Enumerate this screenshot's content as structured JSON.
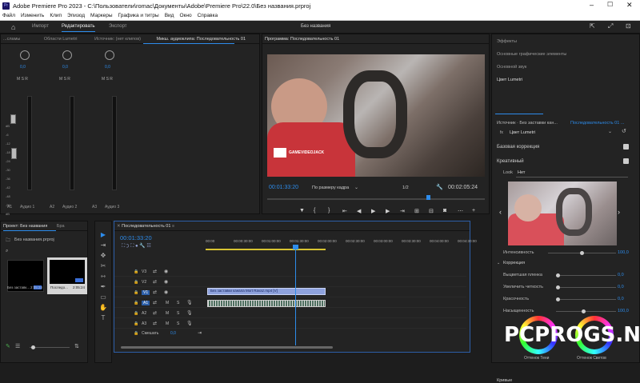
{
  "app": {
    "title": "Adobe Premiere Pro 2023 - C:\\Пользователи\\romac\\Документы\\Adobe\\Premiere Pro\\22.0\\Без названия.prproj",
    "project_name": "Без названия"
  },
  "menu": [
    "Файл",
    "Изменить",
    "Клип",
    "Эпизод",
    "Маркеры",
    "Графика и титры",
    "Вид",
    "Окно",
    "Справка"
  ],
  "workspaces": {
    "import": "Импорт",
    "edit": "Редактировать",
    "export": "Экспорт"
  },
  "source_panel": {
    "tabs": [
      "...сламы",
      "Области Lumetri",
      "Источник: (нет клипов)",
      "Микш. аудиоклипа: Последовательность 01"
    ]
  },
  "mixer": {
    "channels": [
      {
        "name": "Аудио 1",
        "track": "A1",
        "value": "0,0"
      },
      {
        "name": "Аудио 2",
        "track": "A2",
        "value": "0,0"
      },
      {
        "name": "Аудио 3",
        "track": "A3",
        "value": "0,0"
      }
    ],
    "scale": [
      "dB",
      "-6",
      "-12",
      "-18",
      "-24",
      "-30",
      "-36",
      "-42",
      "-48",
      "-54",
      "dB"
    ],
    "buttons": [
      "M",
      "S",
      "R"
    ]
  },
  "program": {
    "title": "Программа: Последовательность 01",
    "timecode": "00:01:33:20",
    "fit": "По размеру кадра",
    "zoom": "1/2",
    "duration": "00:02:05:24",
    "watermark": "GAMEVIDEOJACK"
  },
  "effects": {
    "items": [
      "Эффекты",
      "Основные графические элементы",
      "Основной звук",
      "Цвет Lumetri"
    ],
    "source_label": "Источник · Без заставки кан...",
    "sequence_label": "Последовательность 01 ...",
    "fx_name": "Цвет Lumetri",
    "basic": "Базовая коррекция",
    "creative": "Креативный",
    "look_label": "Look",
    "look_value": "Нет",
    "intensity_label": "Интенсивность",
    "intensity_value": "100,0",
    "adjust_label": "Коррекция",
    "params": [
      {
        "label": "Выцветшая пленка",
        "value": "0,0"
      },
      {
        "label": "Увеличить четкость",
        "value": "0,0"
      },
      {
        "label": "Красочность",
        "value": "0,0"
      },
      {
        "label": "Насыщенность",
        "value": "100,0"
      }
    ],
    "wheel_left": "Оттенок Тени",
    "wheel_right": "Оттенок Светов",
    "bottom": "Кривые"
  },
  "project": {
    "tabs": [
      "Проект: Без названия",
      "Бра"
    ],
    "file": "Без названия.prproj",
    "items": [
      {
        "name": "Без заставк...",
        "duration": "2:05:24"
      },
      {
        "name": "Последо...",
        "duration": "2:05:24"
      }
    ]
  },
  "timeline": {
    "tab": "Последовательность 01",
    "timecode": "00:01:33:20",
    "ruler": [
      "00:00",
      "00:00:30:00",
      "00:01:00:00",
      "00:01:30:00",
      "00:02:00:00",
      "00:02:30:00",
      "00:03:00:00",
      "00:03:30:00",
      "00:04:00:00",
      "00:04:30:00"
    ],
    "video_tracks": [
      "V3",
      "V2",
      "V1"
    ],
    "audio_tracks": [
      "A1",
      "A2",
      "A3"
    ],
    "mix_label": "Смешать",
    "mix_value": "0,0",
    "clip": "Без заставки канала Mort Ravaz.mp4 [V]",
    "track_buttons": [
      "M",
      "S"
    ]
  },
  "watermark": "PCPROGS.NET"
}
